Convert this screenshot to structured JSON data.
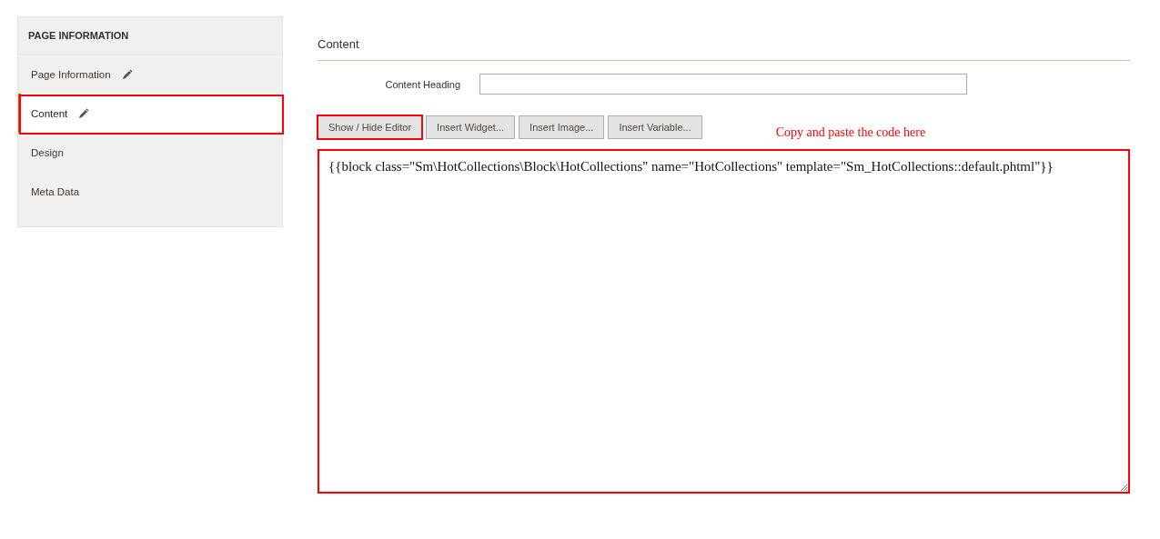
{
  "sidebar": {
    "title": "PAGE INFORMATION",
    "items": [
      {
        "label": "Page Information",
        "selected": false,
        "edited": true,
        "highlighted": false
      },
      {
        "label": "Content",
        "selected": true,
        "edited": true,
        "highlighted": true
      },
      {
        "label": "Design",
        "selected": false,
        "edited": false,
        "highlighted": false
      },
      {
        "label": "Meta Data",
        "selected": false,
        "edited": false,
        "highlighted": false
      }
    ]
  },
  "section": {
    "title": "Content",
    "heading_field": {
      "label": "Content Heading"
    },
    "buttons": [
      {
        "label": "Show / Hide Editor",
        "highlighted": true
      },
      {
        "label": "Insert Widget...",
        "highlighted": false
      },
      {
        "label": "Insert Image...",
        "highlighted": false
      },
      {
        "label": "Insert Variable...",
        "highlighted": false
      }
    ],
    "annotation": "Copy and paste the code here",
    "editor": {
      "value": "{{block class=\"Sm\\HotCollections\\Block\\HotCollections\" name=\"HotCollections\" template=\"Sm_HotCollections::default.phtml\"}}",
      "highlighted": true
    }
  }
}
